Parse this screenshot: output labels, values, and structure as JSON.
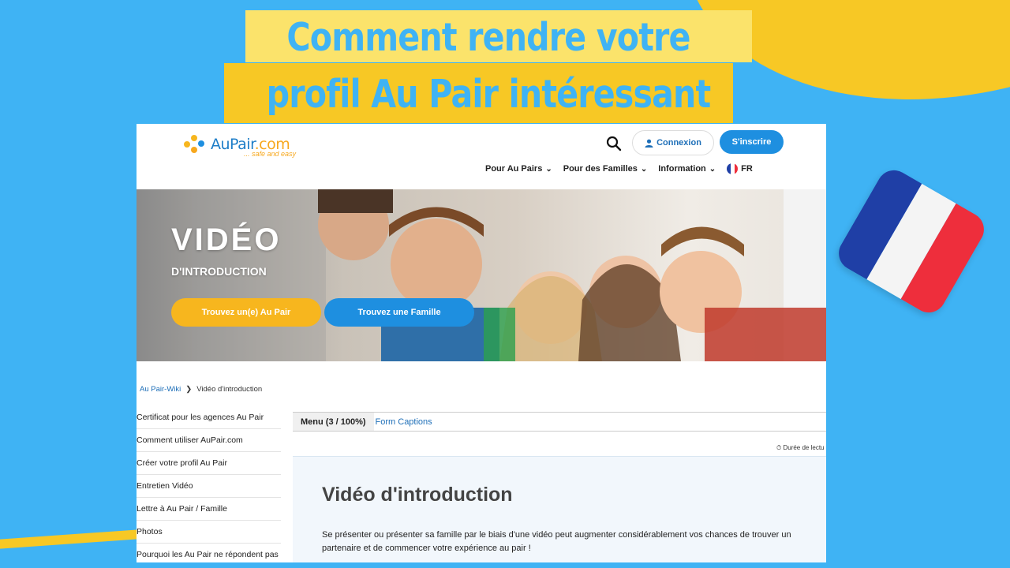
{
  "banner": {
    "line1": "Comment rendre votre",
    "line2": "profil Au Pair intéressant"
  },
  "site": {
    "logo": {
      "text_au": "AuPair",
      "text_com": ".com",
      "tagline": "... safe and easy"
    },
    "header": {
      "search_icon": "search-icon",
      "connexion_label": "Connexion",
      "inscrire_label": "S'inscrire"
    },
    "nav": [
      {
        "label": "Pour Au Pairs"
      },
      {
        "label": "Pour des Familles"
      },
      {
        "label": "Information"
      },
      {
        "label": "FR"
      }
    ],
    "hero": {
      "title": "VIDÉO",
      "subtitle": "D'INTRODUCTION",
      "btn_au_pair": "Trouvez un(e) Au Pair",
      "btn_famille": "Trouvez une Famille"
    },
    "breadcrumb": {
      "root": "Au Pair-Wiki",
      "sep": "❯",
      "current": "Vidéo d'introduction"
    },
    "sidebar": [
      "Certificat pour les agences Au Pair",
      "Comment utiliser AuPair.com",
      "Créer votre profil Au Pair",
      "Entretien Vidéo",
      "Lettre à Au Pair / Famille",
      "Photos",
      "Pourquoi les Au Pair ne répondent pas"
    ],
    "tabs": {
      "menu": "Menu (3 / 100%)",
      "captions": "Form Captions"
    },
    "reading_time": "⏱ Durée de lectu",
    "article": {
      "title": "Vidéo d'introduction",
      "body": "Se présenter ou présenter sa famille par le biais d'une vidéo peut augmenter considérablement vos chances de trouver un partenaire et de commencer votre expérience au pair !"
    }
  },
  "colors": {
    "background": "#3fb3f4",
    "yellow": "#f7c825",
    "brand_blue": "#1e8fe0",
    "brand_orange": "#f7b61e"
  }
}
